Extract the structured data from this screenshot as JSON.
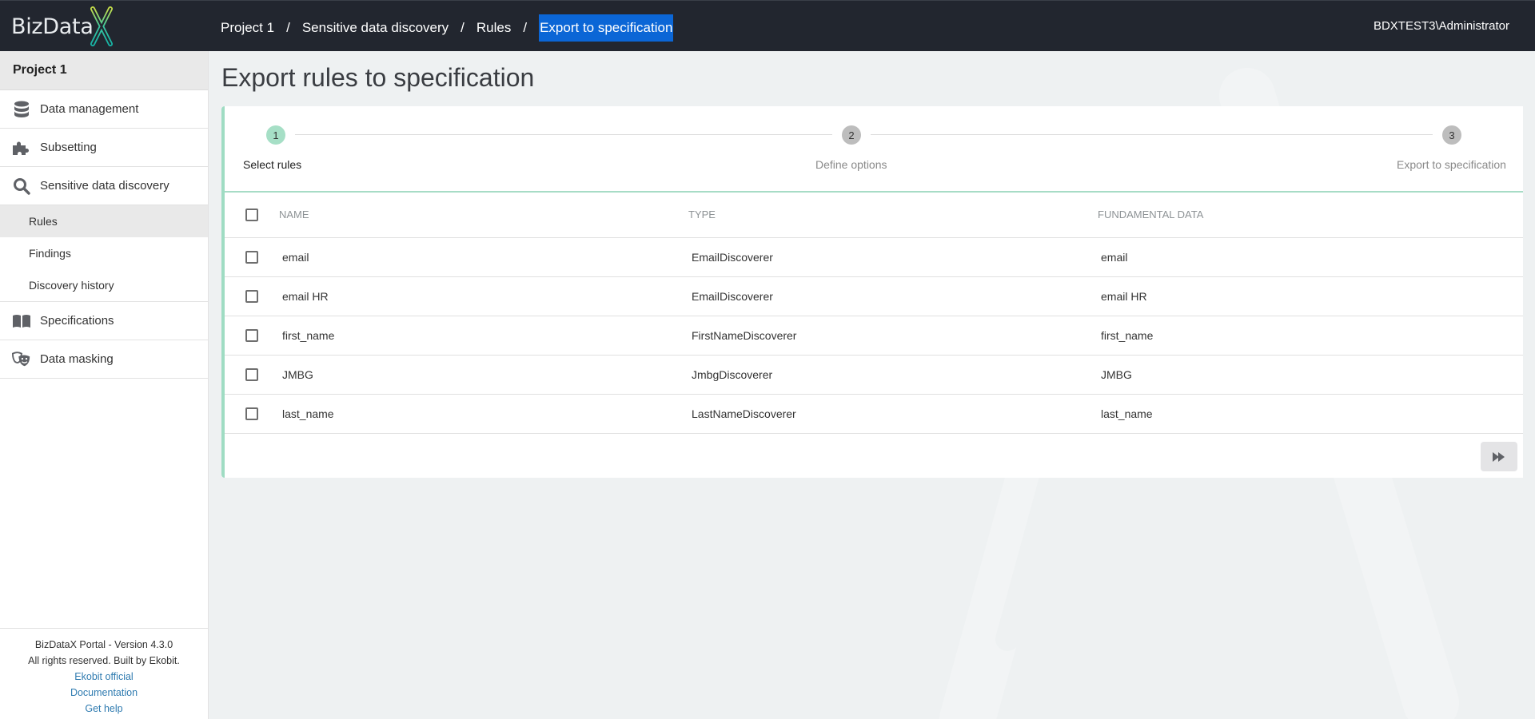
{
  "header": {
    "logo_text": "BizData",
    "breadcrumb": [
      {
        "label": "Project 1"
      },
      {
        "label": "Sensitive data discovery"
      },
      {
        "label": "Rules"
      },
      {
        "label": "Export to specification"
      }
    ],
    "separator": "/",
    "user": "BDXTEST3\\Administrator"
  },
  "sidebar": {
    "project": "Project 1",
    "items": [
      {
        "label": "Data management",
        "icon": "database-icon"
      },
      {
        "label": "Subsetting",
        "icon": "puzzle-icon"
      },
      {
        "label": "Sensitive data discovery",
        "icon": "search-icon"
      },
      {
        "label": "Specifications",
        "icon": "book-icon"
      },
      {
        "label": "Data masking",
        "icon": "theater-masks-icon"
      }
    ],
    "sub_items": [
      {
        "label": "Rules",
        "active": true
      },
      {
        "label": "Findings",
        "active": false
      },
      {
        "label": "Discovery history",
        "active": false
      }
    ],
    "footer": {
      "version": "BizDataX Portal - Version 4.3.0",
      "rights": "All rights reserved. Built by Ekobit.",
      "links": [
        "Ekobit official",
        "Documentation",
        "Get help"
      ]
    }
  },
  "main": {
    "title": "Export rules to specification",
    "stepper": {
      "steps": [
        {
          "number": "1",
          "label": "Select rules",
          "active": true
        },
        {
          "number": "2",
          "label": "Define options",
          "active": false
        },
        {
          "number": "3",
          "label": "Export to specification",
          "active": false
        }
      ]
    },
    "table": {
      "columns": [
        "NAME",
        "TYPE",
        "FUNDAMENTAL DATA"
      ],
      "rows": [
        {
          "name": "email",
          "type": "EmailDiscoverer",
          "fundamental": "email",
          "checked": false
        },
        {
          "name": "email HR",
          "type": "EmailDiscoverer",
          "fundamental": "email HR",
          "checked": false
        },
        {
          "name": "first_name",
          "type": "FirstNameDiscoverer",
          "fundamental": "first_name",
          "checked": false
        },
        {
          "name": "JMBG",
          "type": "JmbgDiscoverer",
          "fundamental": "JMBG",
          "checked": false
        },
        {
          "name": "last_name",
          "type": "LastNameDiscoverer",
          "fundamental": "last_name",
          "checked": false
        }
      ]
    },
    "next_button": {
      "icon": "fast-forward-icon",
      "title": "Next"
    }
  },
  "colors": {
    "header_bg": "#22262f",
    "accent_green": "#a6dfc6",
    "active_crumb": "#0b66d6",
    "link": "#2f7bb0"
  }
}
